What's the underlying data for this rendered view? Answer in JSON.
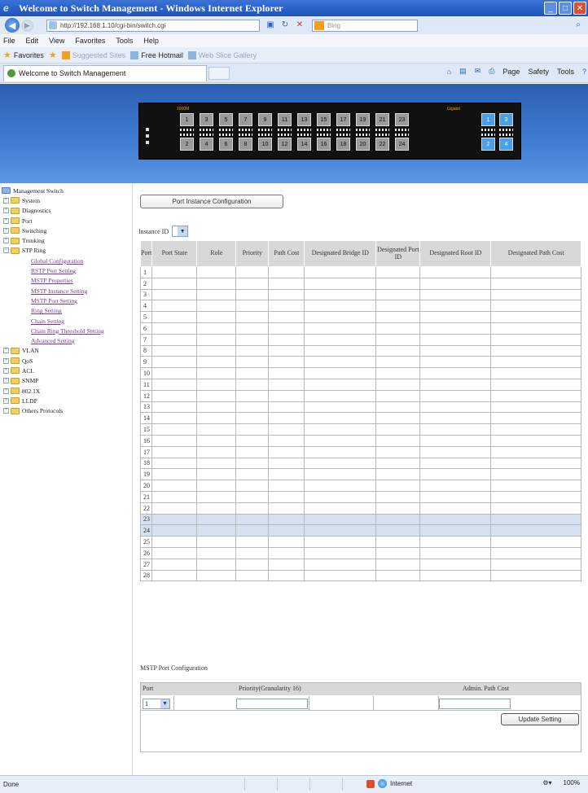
{
  "window": {
    "title": "Welcome to Switch Management - Windows Internet Explorer"
  },
  "address": {
    "url": "http://192.168.1.10/cgi-bin/switch.cgi",
    "search_placeholder": "Bing"
  },
  "menu": [
    "File",
    "Edit",
    "View",
    "Favorites",
    "Tools",
    "Help"
  ],
  "favorites": {
    "label": "Favorites",
    "items": [
      "Suggested Sites",
      "Free Hotmail",
      "Web Slice Gallery"
    ]
  },
  "tab": {
    "title": "Welcome to Switch Management"
  },
  "commands": {
    "page": "Page",
    "safety": "Safety",
    "tools": "Tools"
  },
  "switch_panel": {
    "left_label": "1000M",
    "right_label": "Gigabit",
    "top_ports": [
      "1",
      "3",
      "5",
      "7",
      "9",
      "11",
      "13",
      "15",
      "17",
      "19",
      "21",
      "23"
    ],
    "bottom_ports": [
      "2",
      "4",
      "6",
      "8",
      "10",
      "12",
      "14",
      "16",
      "18",
      "20",
      "22",
      "24"
    ],
    "gig_top": [
      "1",
      "3"
    ],
    "gig_bottom": [
      "2",
      "4"
    ]
  },
  "sidebar": {
    "items": [
      {
        "label": "Management Switch",
        "level": "root"
      },
      {
        "label": "System",
        "level": "folder"
      },
      {
        "label": "Diagnostics",
        "level": "folder"
      },
      {
        "label": "Port",
        "level": "folder"
      },
      {
        "label": "Switching",
        "level": "folder"
      },
      {
        "label": "Trunking",
        "level": "folder"
      },
      {
        "label": "STP Ring",
        "level": "folder-open"
      },
      {
        "label": "Global Configuration",
        "level": "sub"
      },
      {
        "label": "RSTP Port Setting",
        "level": "sub"
      },
      {
        "label": "MSTP Properties",
        "level": "sub"
      },
      {
        "label": "MSTP Instance Setting",
        "level": "sub"
      },
      {
        "label": "MSTP Port Setting",
        "level": "sub"
      },
      {
        "label": "Ring Setting",
        "level": "sub"
      },
      {
        "label": "Chain Setting",
        "level": "sub"
      },
      {
        "label": "Chain Ring Threshold Setting",
        "level": "sub"
      },
      {
        "label": "Advanced Setting",
        "level": "sub"
      },
      {
        "label": "VLAN",
        "level": "folder"
      },
      {
        "label": "QoS",
        "level": "folder"
      },
      {
        "label": "ACL",
        "level": "folder"
      },
      {
        "label": "SNMP",
        "level": "folder"
      },
      {
        "label": "802.1X",
        "level": "folder"
      },
      {
        "label": "LLDP",
        "level": "folder"
      },
      {
        "label": "Others Protocols",
        "level": "folder"
      }
    ]
  },
  "main": {
    "instance_button": "Port Instance Configuration",
    "instance_label": "Instance ID",
    "table": {
      "headers": [
        "Port",
        "Port State",
        "Role",
        "Priority",
        "Path Cost",
        "Designated Bridge ID",
        "Designated Port ID",
        "Designated Root ID",
        "Designated Path Cost"
      ],
      "rows": [
        "1",
        "2",
        "3",
        "4",
        "5",
        "6",
        "7",
        "8",
        "9",
        "10",
        "11",
        "12",
        "13",
        "14",
        "15",
        "16",
        "17",
        "18",
        "19",
        "20",
        "21",
        "22",
        "23",
        "24",
        "25",
        "26",
        "27",
        "28"
      ],
      "highlighted": [
        "23",
        "24"
      ]
    },
    "mstp_title": "MSTP Port Configuration",
    "config": {
      "headers": {
        "port": "Port",
        "priority": "Priority(Granularity 16)",
        "admin": "Admin. Path Cost"
      },
      "port_value": "1",
      "update_button": "Update Setting"
    }
  },
  "status": {
    "left": "Done",
    "zone": "Internet",
    "zoom": "100%"
  }
}
